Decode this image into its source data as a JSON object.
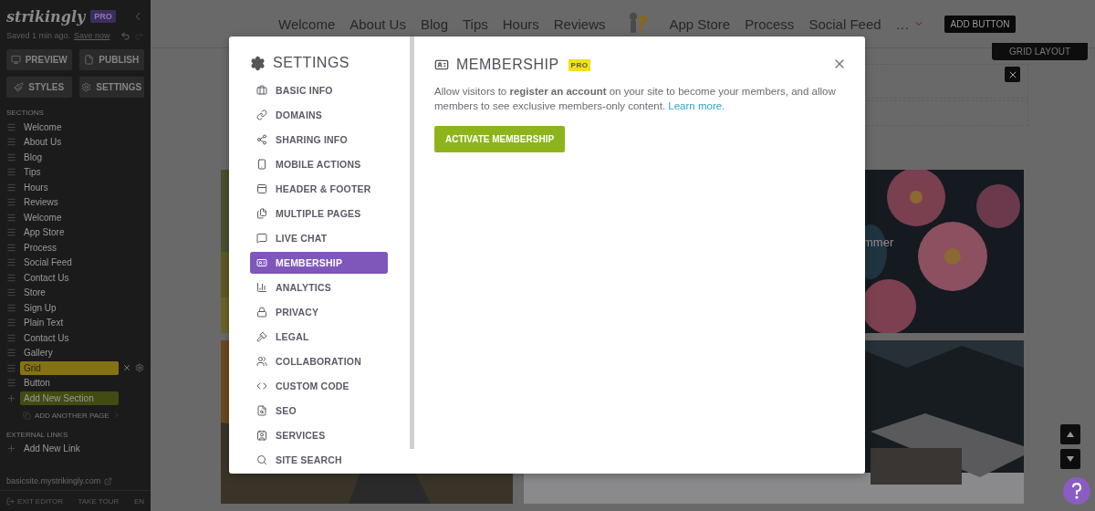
{
  "sidebar": {
    "logo": "strikingly",
    "badge": "PRO",
    "save_status": "Saved 1 min ago.",
    "save_link": "Save now",
    "buttons": [
      {
        "label": "PREVIEW",
        "kind": "preview"
      },
      {
        "label": "PUBLISH",
        "kind": "publish"
      },
      {
        "label": "STYLES",
        "kind": "styles"
      },
      {
        "label": "SETTINGS",
        "kind": "settings"
      }
    ],
    "sections_heading": "SECTIONS",
    "sections": [
      {
        "label": "Welcome",
        "selected": false
      },
      {
        "label": "About Us",
        "selected": false
      },
      {
        "label": "Blog",
        "selected": false
      },
      {
        "label": "Tips",
        "selected": false
      },
      {
        "label": "Hours",
        "selected": false
      },
      {
        "label": "Reviews",
        "selected": false
      },
      {
        "label": "Welcome",
        "selected": false
      },
      {
        "label": "App Store",
        "selected": false
      },
      {
        "label": "Process",
        "selected": false
      },
      {
        "label": "Social Feed",
        "selected": false
      },
      {
        "label": "Contact Us",
        "selected": false
      },
      {
        "label": "Store",
        "selected": false
      },
      {
        "label": "Sign Up",
        "selected": false
      },
      {
        "label": "Plain Text",
        "selected": false
      },
      {
        "label": "Contact Us",
        "selected": false
      },
      {
        "label": "Gallery",
        "selected": false
      },
      {
        "label": "Grid",
        "selected": true
      },
      {
        "label": "Button",
        "selected": false
      }
    ],
    "add_section": "Add New Section",
    "add_page": "ADD ANOTHER PAGE",
    "external_links_heading": "EXTERNAL LINKS",
    "add_link": "Add New Link",
    "site_url": "basicsite.mystrikingly.com",
    "footer": [
      "EXIT EDITOR",
      "TAKE TOUR",
      "EN"
    ]
  },
  "site": {
    "nav": [
      "Welcome",
      "About Us",
      "Blog",
      "Tips",
      "Hours",
      "Reviews"
    ],
    "nav_after_logo": [
      "App Store",
      "Process",
      "Social Feed"
    ],
    "more": "…",
    "add_button": "ADD BUTTON",
    "grid_layout": "GRID LAYOUT",
    "caption": "mmer"
  },
  "modal": {
    "title": "SETTINGS",
    "menu": [
      {
        "label": "BASIC INFO",
        "selected": false
      },
      {
        "label": "DOMAINS",
        "selected": false
      },
      {
        "label": "SHARING INFO",
        "selected": false
      },
      {
        "label": "MOBILE ACTIONS",
        "selected": false
      },
      {
        "label": "HEADER & FOOTER",
        "selected": false
      },
      {
        "label": "MULTIPLE PAGES",
        "selected": false
      },
      {
        "label": "LIVE CHAT",
        "selected": false
      },
      {
        "label": "MEMBERSHIP",
        "selected": true
      },
      {
        "label": "ANALYTICS",
        "selected": false
      },
      {
        "label": "PRIVACY",
        "selected": false
      },
      {
        "label": "LEGAL",
        "selected": false
      },
      {
        "label": "COLLABORATION",
        "selected": false
      },
      {
        "label": "CUSTOM CODE",
        "selected": false
      },
      {
        "label": "SEO",
        "selected": false
      },
      {
        "label": "SERVICES",
        "selected": false
      },
      {
        "label": "SITE SEARCH",
        "selected": false
      }
    ],
    "panel_title": "MEMBERSHIP",
    "panel_badge": "PRO",
    "description": "Allow visitors to **register an account** on your site to become your members, and allow members to see exclusive members-only content.",
    "learn_more": "Learn more.",
    "action": "ACTIVATE MEMBERSHIP"
  }
}
